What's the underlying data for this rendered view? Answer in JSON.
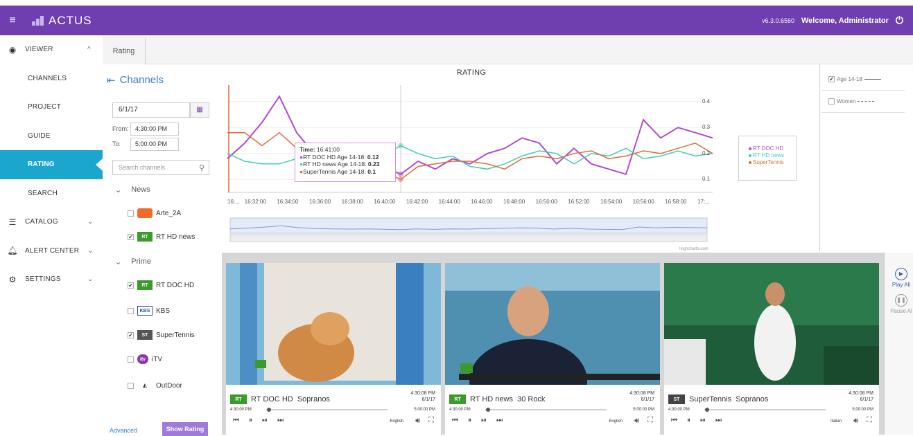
{
  "app": {
    "name": "ACTUS",
    "version": "v6.3.0.6560",
    "welcome": "Welcome, Administrator"
  },
  "sidebar": {
    "items": [
      {
        "label": "VIEWER",
        "icon": "eye-icon",
        "caret": "^"
      },
      {
        "label": "CHANNELS"
      },
      {
        "label": "PROJECT"
      },
      {
        "label": "GUIDE"
      },
      {
        "label": "RATING",
        "active": true
      },
      {
        "label": "SEARCH"
      },
      {
        "label": "CATALOG",
        "icon": "list-icon",
        "caret": "v"
      },
      {
        "label": "ALERT CENTER",
        "icon": "bell-icon",
        "caret": "v"
      },
      {
        "label": "SETTINGS",
        "icon": "gear-icon",
        "caret": "v"
      }
    ]
  },
  "tabs": [
    {
      "label": "Rating"
    }
  ],
  "channels_panel": {
    "title": "Channels",
    "date": "6/1/17",
    "from_label": "From:",
    "from_value": "4:30:00 PM",
    "to_label": "To:",
    "to_value": "5:00:00 PM",
    "search_placeholder": "Search channels",
    "groups": [
      {
        "name": "News",
        "channels": [
          {
            "name": "Arte_2A",
            "checked": false
          },
          {
            "name": "RT HD news",
            "checked": true
          }
        ]
      },
      {
        "name": "Prime",
        "channels": [
          {
            "name": "RT DOC HD",
            "checked": true
          },
          {
            "name": "KBS",
            "checked": false
          },
          {
            "name": "SuperTennis",
            "checked": true
          },
          {
            "name": "iTV",
            "checked": false
          },
          {
            "name": "OutDoor",
            "checked": false
          }
        ]
      }
    ],
    "advanced_label": "Advanced",
    "show_rating_label": "Show Rating"
  },
  "chart_data": {
    "type": "line",
    "title": "RATING",
    "x": [
      "16:31:00",
      "16:32:00",
      "16:33:00",
      "16:34:00",
      "16:35:00",
      "16:36:00",
      "16:37:00",
      "16:38:00",
      "16:39:00",
      "16:40:00",
      "16:41:00",
      "16:42:00",
      "16:43:00",
      "16:44:00",
      "16:45:00",
      "16:46:00",
      "16:47:00",
      "16:48:00",
      "16:49:00",
      "16:50:00",
      "16:51:00",
      "16:52:00",
      "16:53:00",
      "16:54:00",
      "16:55:00",
      "16:56:00",
      "16:57:00",
      "16:58:00",
      "16:59:00"
    ],
    "xticks": [
      "16:...",
      "16:32:00",
      "16:34:00",
      "16:36:00",
      "16:38:00",
      "16:40:00",
      "16:42:00",
      "16:44:00",
      "16:46:00",
      "16:48:00",
      "16:50:00",
      "16:52:00",
      "16:54:00",
      "16:56:00",
      "16:58:00",
      "17:..."
    ],
    "yticks": [
      "0.4",
      "0.3",
      "0.2",
      "0.1"
    ],
    "ylim": [
      0.05,
      0.45
    ],
    "series": [
      {
        "name": "RT DOC HD",
        "color": "#b04ad0",
        "values": [
          0.18,
          0.24,
          0.32,
          0.42,
          0.28,
          0.2,
          0.17,
          0.16,
          0.18,
          0.15,
          0.12,
          0.17,
          0.14,
          0.18,
          0.16,
          0.2,
          0.22,
          0.26,
          0.24,
          0.16,
          0.22,
          0.16,
          0.14,
          0.12,
          0.33,
          0.26,
          0.3,
          0.28,
          0.26
        ]
      },
      {
        "name": "RT HD news",
        "color": "#3ecfb0",
        "values": [
          0.2,
          0.17,
          0.16,
          0.16,
          0.18,
          0.17,
          0.19,
          0.24,
          0.21,
          0.19,
          0.23,
          0.2,
          0.18,
          0.19,
          0.15,
          0.14,
          0.16,
          0.19,
          0.21,
          0.2,
          0.16,
          0.2,
          0.19,
          0.22,
          0.18,
          0.19,
          0.21,
          0.19,
          0.2
        ]
      },
      {
        "name": "SuperTennis",
        "color": "#e06a3a",
        "values": [
          0.28,
          0.28,
          0.23,
          0.28,
          0.22,
          0.18,
          0.18,
          0.2,
          0.19,
          0.13,
          0.1,
          0.15,
          0.16,
          0.17,
          0.17,
          0.16,
          0.14,
          0.18,
          0.19,
          0.18,
          0.2,
          0.21,
          0.18,
          0.19,
          0.21,
          0.2,
          0.22,
          0.24,
          0.2
        ]
      }
    ],
    "legend": "right",
    "tooltip": {
      "time_label": "Time:",
      "time": "16:41:00",
      "rows": [
        {
          "label": "RT DOC HD Age 14-18:",
          "value": "0.12"
        },
        {
          "label": "RT HD news Age 14-18:",
          "value": "0.23"
        },
        {
          "label": "SuperTennis Age 14-18:",
          "value": "0.1"
        }
      ]
    },
    "credits": "Highcharts.com"
  },
  "filters": [
    {
      "label": "Age 14-18",
      "checked": true
    },
    {
      "label": "Women",
      "checked": false
    }
  ],
  "videos": [
    {
      "channel": "RT DOC HD",
      "program": "Sopranos",
      "time": "4:30:08 PM",
      "date": "6/1/17",
      "start": "4:30:00 PM",
      "end": "5:00:00 PM",
      "language": "English",
      "progress": 0.02,
      "logo_color": "#3a9a2a",
      "logo_text": "RT"
    },
    {
      "channel": "RT HD news",
      "program": "30 Rock",
      "time": "4:30:08 PM",
      "date": "6/1/17",
      "start": "4:30:00 PM",
      "end": "5:00:00 PM",
      "language": "English",
      "progress": 0.02,
      "logo_color": "#3a9a2a",
      "logo_text": "RT"
    },
    {
      "channel": "SuperTennis",
      "program": "Sopranos",
      "time": "4:30:08 PM",
      "date": "6/1/17",
      "start": "4:30:00 PM",
      "end": "5:00:00 PM",
      "language": "Italian",
      "progress": 0.02,
      "logo_color": "#444444",
      "logo_text": "ST"
    }
  ],
  "controls": {
    "play_all": "Play All",
    "pause_all": "Pause Al"
  }
}
